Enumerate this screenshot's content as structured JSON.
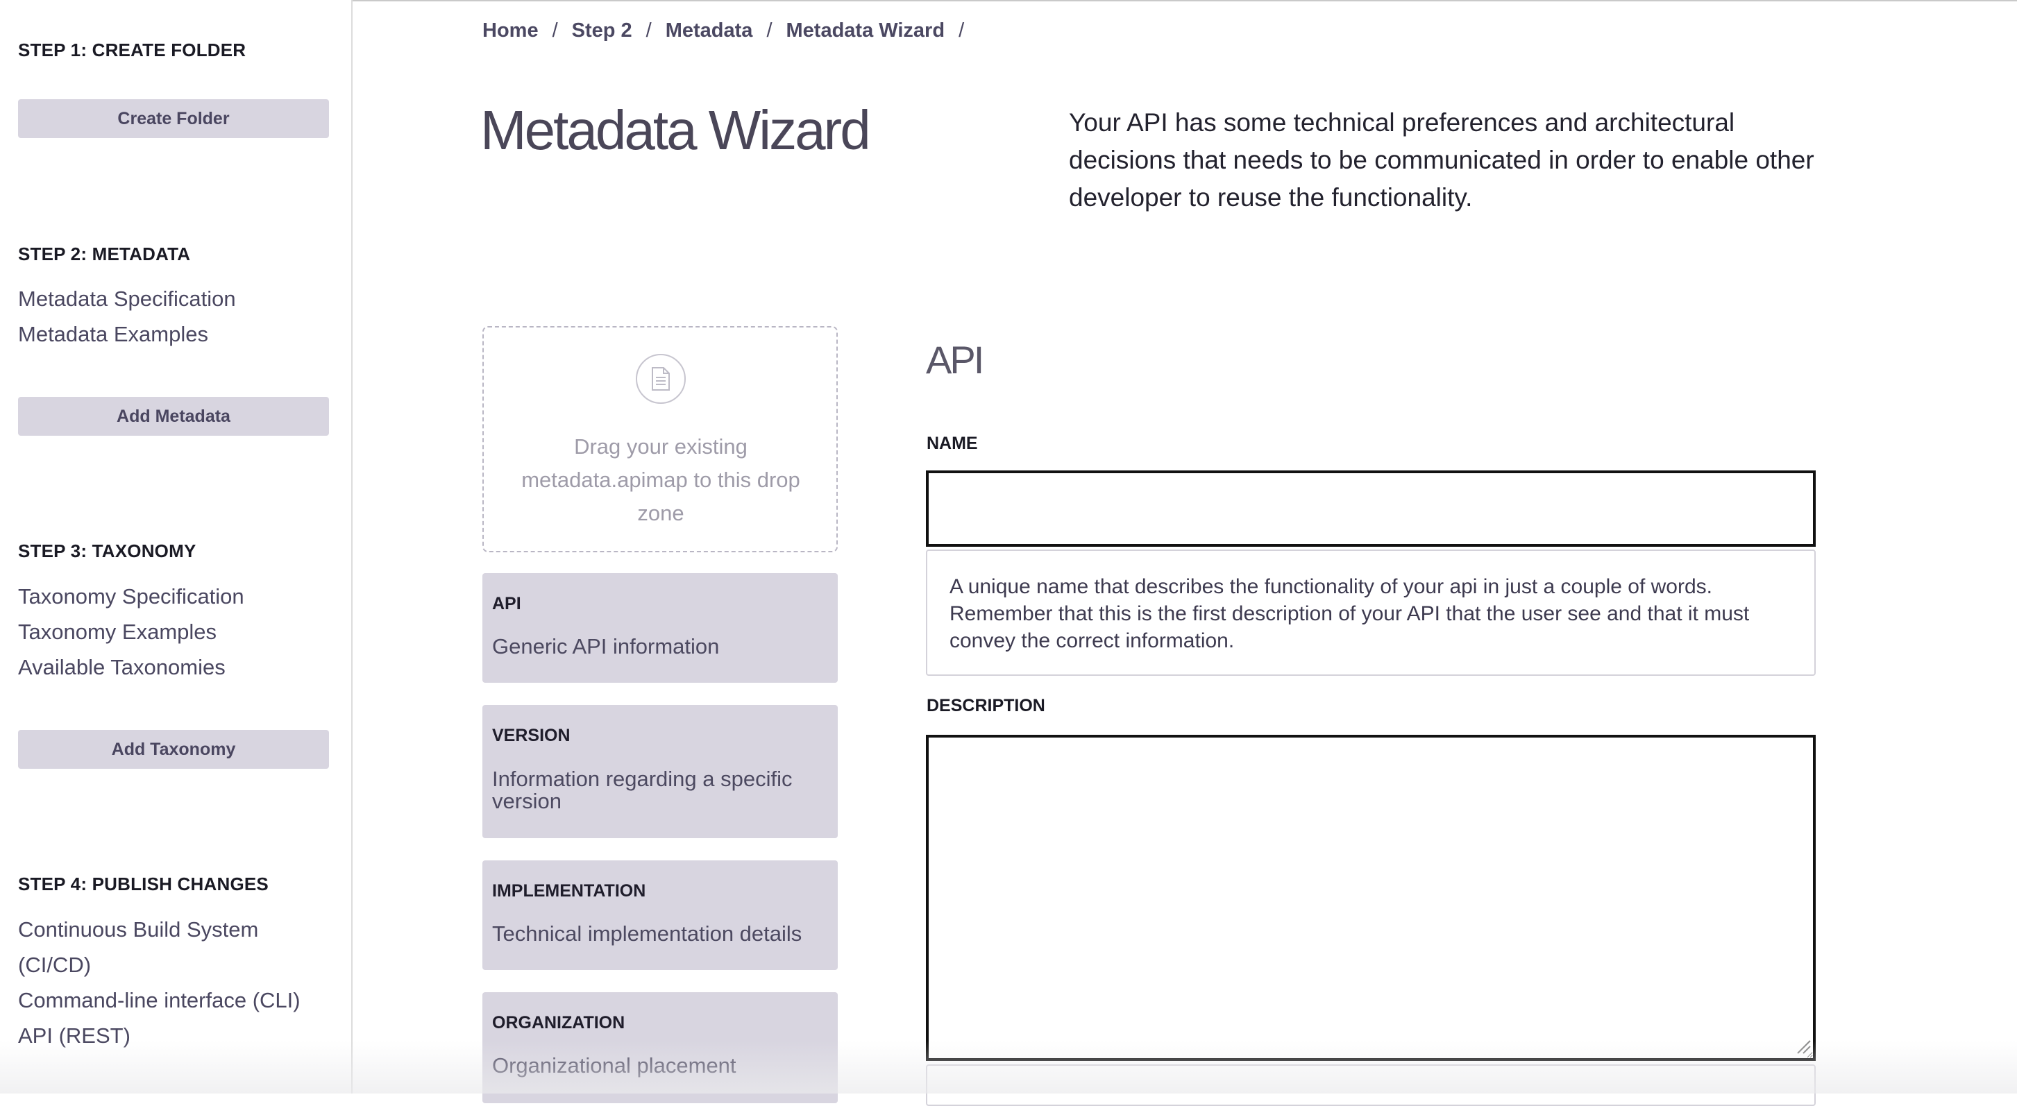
{
  "sidebar": {
    "step1": {
      "heading": "STEP 1: CREATE FOLDER",
      "button": "Create Folder"
    },
    "step2": {
      "heading": "STEP 2: METADATA",
      "links": [
        "Metadata Specification",
        "Metadata Examples"
      ],
      "button": "Add Metadata"
    },
    "step3": {
      "heading": "STEP 3: TAXONOMY",
      "links": [
        "Taxonomy Specification",
        "Taxonomy Examples",
        "Available Taxonomies"
      ],
      "button": "Add Taxonomy"
    },
    "step4": {
      "heading": "STEP 4: PUBLISH CHANGES",
      "links": [
        "Continuous Build System",
        "(CI/CD)",
        "Command-line interface (CLI)",
        "API (REST)"
      ]
    }
  },
  "breadcrumb": {
    "items": [
      "Home",
      "Step 2",
      "Metadata",
      "Metadata Wizard"
    ],
    "separator": "/"
  },
  "page": {
    "title": "Metadata Wizard",
    "intro": "Your API has some technical preferences and architectural decisions that needs to be communicated in order to enable other developer to reuse the functionality."
  },
  "dropzone": {
    "icon": "document-icon",
    "text": "Drag your existing metadata.apimap to this drop zone"
  },
  "sections": [
    {
      "title": "API",
      "description": "Generic API information"
    },
    {
      "title": "VERSION",
      "description": "Information regarding a specific version"
    },
    {
      "title": "IMPLEMENTATION",
      "description": "Technical implementation details"
    },
    {
      "title": "ORGANIZATION",
      "description": "Organizational placement"
    }
  ],
  "form": {
    "section_title": "API",
    "name_label": "NAME",
    "name_value": "",
    "name_help": "A unique name that describes the functionality of your api in just a couple of words. Remember that this is the first description of your API that the user see and that it must convey the correct information.",
    "description_label": "DESCRIPTION",
    "description_value": ""
  }
}
